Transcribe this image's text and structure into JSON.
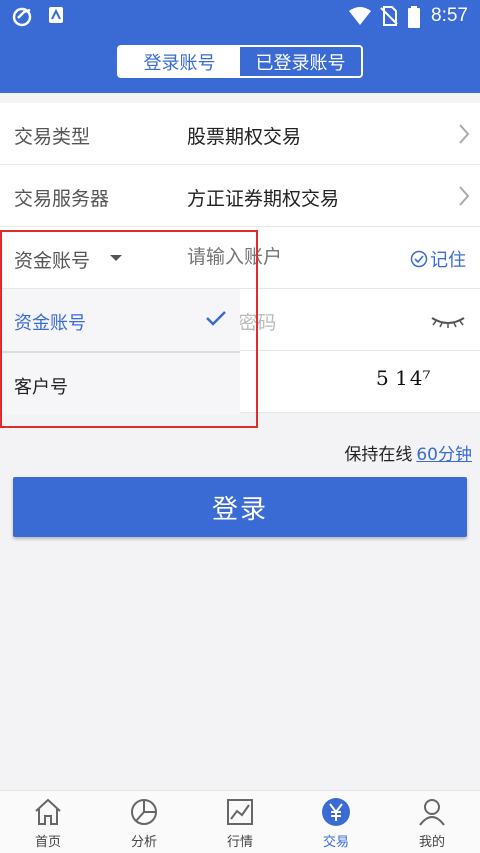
{
  "status_bar": {
    "time": "8:57",
    "icons": [
      "app-icon",
      "notification-icon",
      "wifi-icon",
      "no-sim-icon",
      "battery-icon"
    ]
  },
  "tabs": {
    "active": "登录账号",
    "inactive": "已登录账号"
  },
  "form": {
    "trade_type_label": "交易类型",
    "trade_type_value": "股票期权交易",
    "server_label": "交易服务器",
    "server_value": "方正证券期权交易",
    "account_type_label": "资金账号",
    "account_placeholder": "请输入账户",
    "remember_label": "记住",
    "password_placeholder_partial": "\\密码",
    "captcha": "5 1 4⁷"
  },
  "dropdown": {
    "options": [
      "资金账号",
      "客户号"
    ],
    "selected": "资金账号"
  },
  "keep_online": {
    "label": "保持在线",
    "value": "60分钟"
  },
  "login_button": "登录",
  "bottom_nav": [
    {
      "label": "首页",
      "icon": "home-icon"
    },
    {
      "label": "分析",
      "icon": "pie-chart-icon"
    },
    {
      "label": "行情",
      "icon": "line-chart-icon"
    },
    {
      "label": "交易",
      "icon": "yen-icon",
      "active": true
    },
    {
      "label": "我的",
      "icon": "user-icon"
    }
  ],
  "colors": {
    "primary": "#3a6bd4",
    "highlight": "#e02c2c",
    "background": "#f3f3f6"
  }
}
